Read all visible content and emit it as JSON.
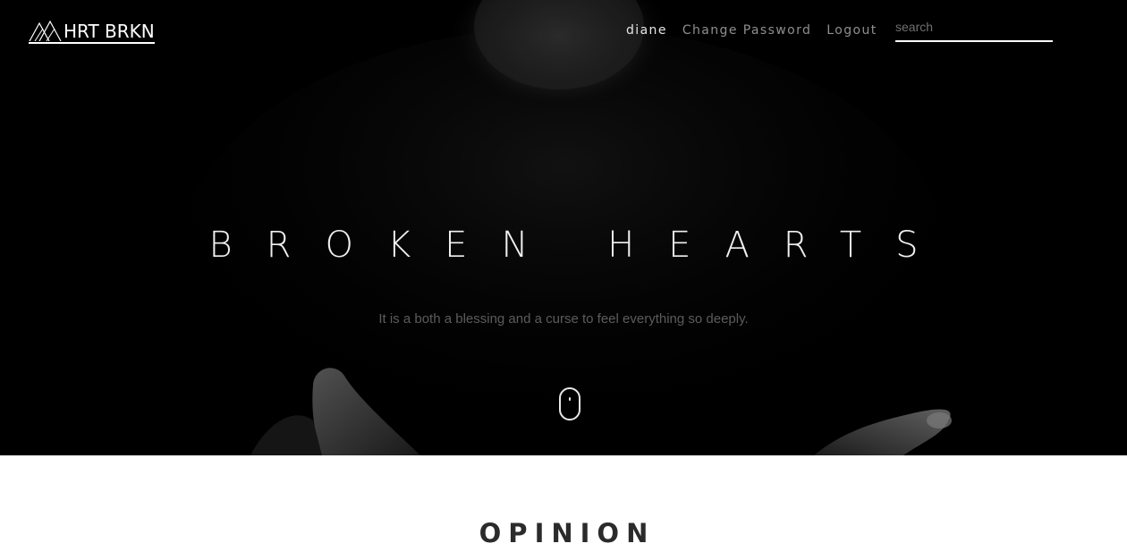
{
  "brand": {
    "name": "HRT BRKN",
    "logo_icon": "mountain-peaks-icon"
  },
  "nav": {
    "user": "diane",
    "change_password": "Change Password",
    "logout": "Logout"
  },
  "search": {
    "placeholder": "search",
    "value": ""
  },
  "hero": {
    "title": "BROKEN HEARTS",
    "subtitle": "It is a both a blessing and a curse to feel everything so deeply.",
    "scroll_icon": "mouse-scroll-icon"
  },
  "section": {
    "title": "OPINION"
  },
  "colors": {
    "hero_bg": "#000000",
    "page_bg": "#ffffff",
    "nav_active": "#e6e6e6",
    "nav_muted": "#8f8f8f",
    "subtitle": "#5c5c5c",
    "section_title": "#2b2b2b"
  }
}
